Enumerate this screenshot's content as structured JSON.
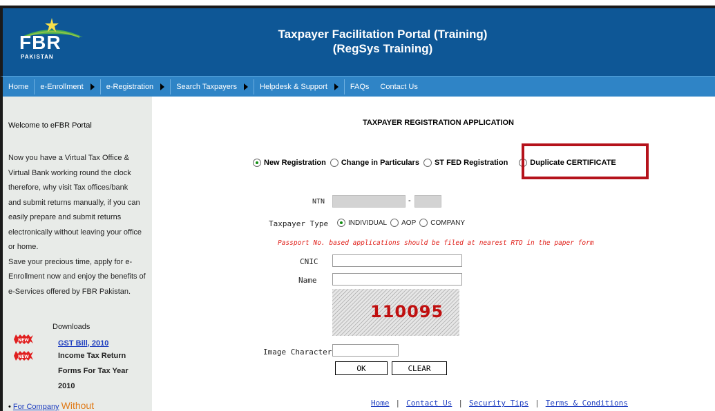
{
  "header": {
    "logo_text": "FBR",
    "logo_sub": "PAKISTAN",
    "title_line1": "Taxpayer Facilitation Portal (Training)",
    "title_line2": "(RegSys Training)"
  },
  "nav": {
    "items": [
      {
        "label": "Home",
        "has_arrow": false
      },
      {
        "label": "e-Enrollment",
        "has_arrow": true
      },
      {
        "label": "e-Registration",
        "has_arrow": true
      },
      {
        "label": "Search Taxpayers",
        "has_arrow": true
      },
      {
        "label": "Helpdesk & Support",
        "has_arrow": true
      },
      {
        "label": "FAQs",
        "has_arrow": false
      },
      {
        "label": "Contact Us",
        "has_arrow": false
      }
    ]
  },
  "sidebar": {
    "welcome": "Welcome to eFBR Portal",
    "body_lines": [
      "Now you have a Virtual Tax Office &",
      "Virtual Bank working round the clock",
      "therefore, why visit Tax offices/bank",
      "and submit returns manually, if you can",
      "easily prepare and submit returns",
      "electronically without leaving your office",
      "or home.",
      "Save your precious time, apply for e-",
      "Enrollment now and enjoy the benefits of",
      "e-Services offered by FBR Pakistan."
    ],
    "downloads_label": "Downloads",
    "badge_text": "NEW",
    "gst_link": "GST Bill, 2010",
    "income_tax_lines": [
      "Income Tax Return",
      "Forms For Tax Year",
      "2010"
    ],
    "bullet_link": "For Company",
    "bullet_big": "Without"
  },
  "main": {
    "title": "TAXPAYER REGISTRATION APPLICATION",
    "registration_options": [
      {
        "label": "New Registration",
        "checked": true
      },
      {
        "label": "Change in Particulars",
        "checked": false
      },
      {
        "label": "ST FED Registration",
        "checked": false
      },
      {
        "label": "Duplicate CERTIFICATE",
        "checked": false
      }
    ],
    "ntn_label": "NTN",
    "ntn_dash": "-",
    "taxpayer_type_label": "Taxpayer Type",
    "taxpayer_types": [
      {
        "label": "INDIVIDUAL",
        "checked": true
      },
      {
        "label": "AOP",
        "checked": false
      },
      {
        "label": "COMPANY",
        "checked": false
      }
    ],
    "warning": "Passport No. based applications should be filed at nearest RTO in the paper form",
    "cnic_label": "CNIC",
    "cnic_value": "",
    "name_label": "Name",
    "name_value": "",
    "captcha_code": "110095",
    "image_character_label": "Image Character",
    "image_character_value": "",
    "ok_label": "OK",
    "clear_label": "CLEAR"
  },
  "footer": {
    "links": [
      "Home",
      "Contact Us",
      "Security Tips",
      "Terms & Conditions"
    ],
    "separator": "|"
  },
  "colors": {
    "header_bg": "#0e5796",
    "nav_bg": "#2f84c6",
    "sidebar_bg": "#e8ebe8",
    "highlight": "#b5121b",
    "warning": "#e0201a",
    "link": "#1c3cbf"
  }
}
